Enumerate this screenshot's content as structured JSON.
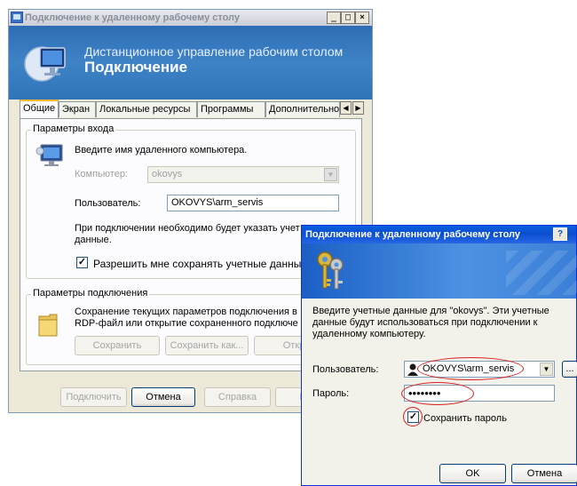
{
  "main_window": {
    "title": "Подключение к удаленному рабочему столу",
    "controls": {
      "minimize": "_",
      "maximize": "□",
      "close": "×"
    },
    "banner": {
      "subtitle": "Дистанционное управление рабочим столом",
      "title": "Подключение"
    },
    "tabs": [
      "Общие",
      "Экран",
      "Локальные ресурсы",
      "Программы",
      "Дополнительно"
    ],
    "tab_scroll": {
      "left": "◀",
      "right": "▶"
    },
    "login_group": {
      "legend": "Параметры входа",
      "prompt": "Введите имя удаленного компьютера.",
      "computer_label": "Компьютер:",
      "computer_value": "okovys",
      "user_label": "Пользователь:",
      "user_value": "OKOVYS\\arm_servis",
      "note_line1": "При подключении необходимо будет указать учет",
      "note_line2": "данные.",
      "save_checkbox_label": "Разрешить мне сохранять учетные данные",
      "save_checked": true
    },
    "connection_group": {
      "legend": "Параметры подключения",
      "desc_line1": "Сохранение текущих параметров подключения в",
      "desc_line2": "RDP-файл или открытие сохраненного подключе",
      "save_button": "Сохранить",
      "save_as_button": "Сохранить как...",
      "open_button": "Откр"
    },
    "footer_buttons": {
      "connect": "Подключить",
      "cancel": "Отмена",
      "help": "Справка",
      "params": "Пар"
    }
  },
  "credentials_dialog": {
    "title": "Подключение к удаленному рабочему столу",
    "help_button": "?",
    "message": "Введите учетные данные для \"okovys\". Эти учетные данные будут использоваться при подключении к удаленному компьютеру.",
    "user_label": "Пользователь:",
    "user_value": "OKOVYS\\arm_servis",
    "browse_button": "...",
    "password_label": "Пароль:",
    "password_value": "••••••••",
    "remember_label": "Сохранить пароль",
    "remember_checked": true,
    "ok_button": "OK",
    "cancel_button": "Отмена"
  },
  "colors": {
    "xp_face": "#ece9d8",
    "title_active": "#0b4fd0",
    "banner_blue": "#2e6db3",
    "annotation_red": "#d91c1c"
  },
  "icons": [
    "remote-desktop-icon",
    "computer-icon",
    "folder-icon",
    "keys-icon",
    "user-icon",
    "check-icon"
  ]
}
